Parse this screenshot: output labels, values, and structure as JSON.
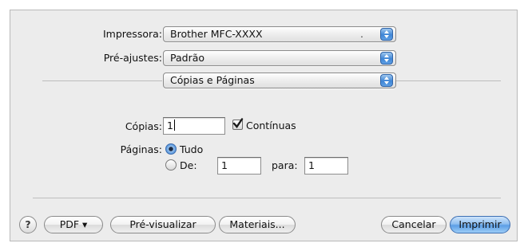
{
  "printer": {
    "label": "Impressora:",
    "value": "Brother MFC-XXXX"
  },
  "presets": {
    "label": "Pré-ajustes:",
    "value": "Padrão"
  },
  "pane": {
    "value": "Cópias e Páginas"
  },
  "copies": {
    "label": "Cópias:",
    "value": "1",
    "collated_label": "Contínuas",
    "collated_checked": true
  },
  "pages": {
    "label": "Páginas:",
    "all_label": "Tudo",
    "all_selected": true,
    "from_label": "De:",
    "from_value": "1",
    "to_label": "para:",
    "to_value": "1"
  },
  "buttons": {
    "help": "?",
    "pdf": "PDF ▾",
    "preview": "Pré-visualizar",
    "supplies": "Materiais...",
    "cancel": "Cancelar",
    "print": "Imprimir"
  },
  "colors": {
    "accent": "#3f86d6",
    "dialog_bg": "#ececec"
  }
}
